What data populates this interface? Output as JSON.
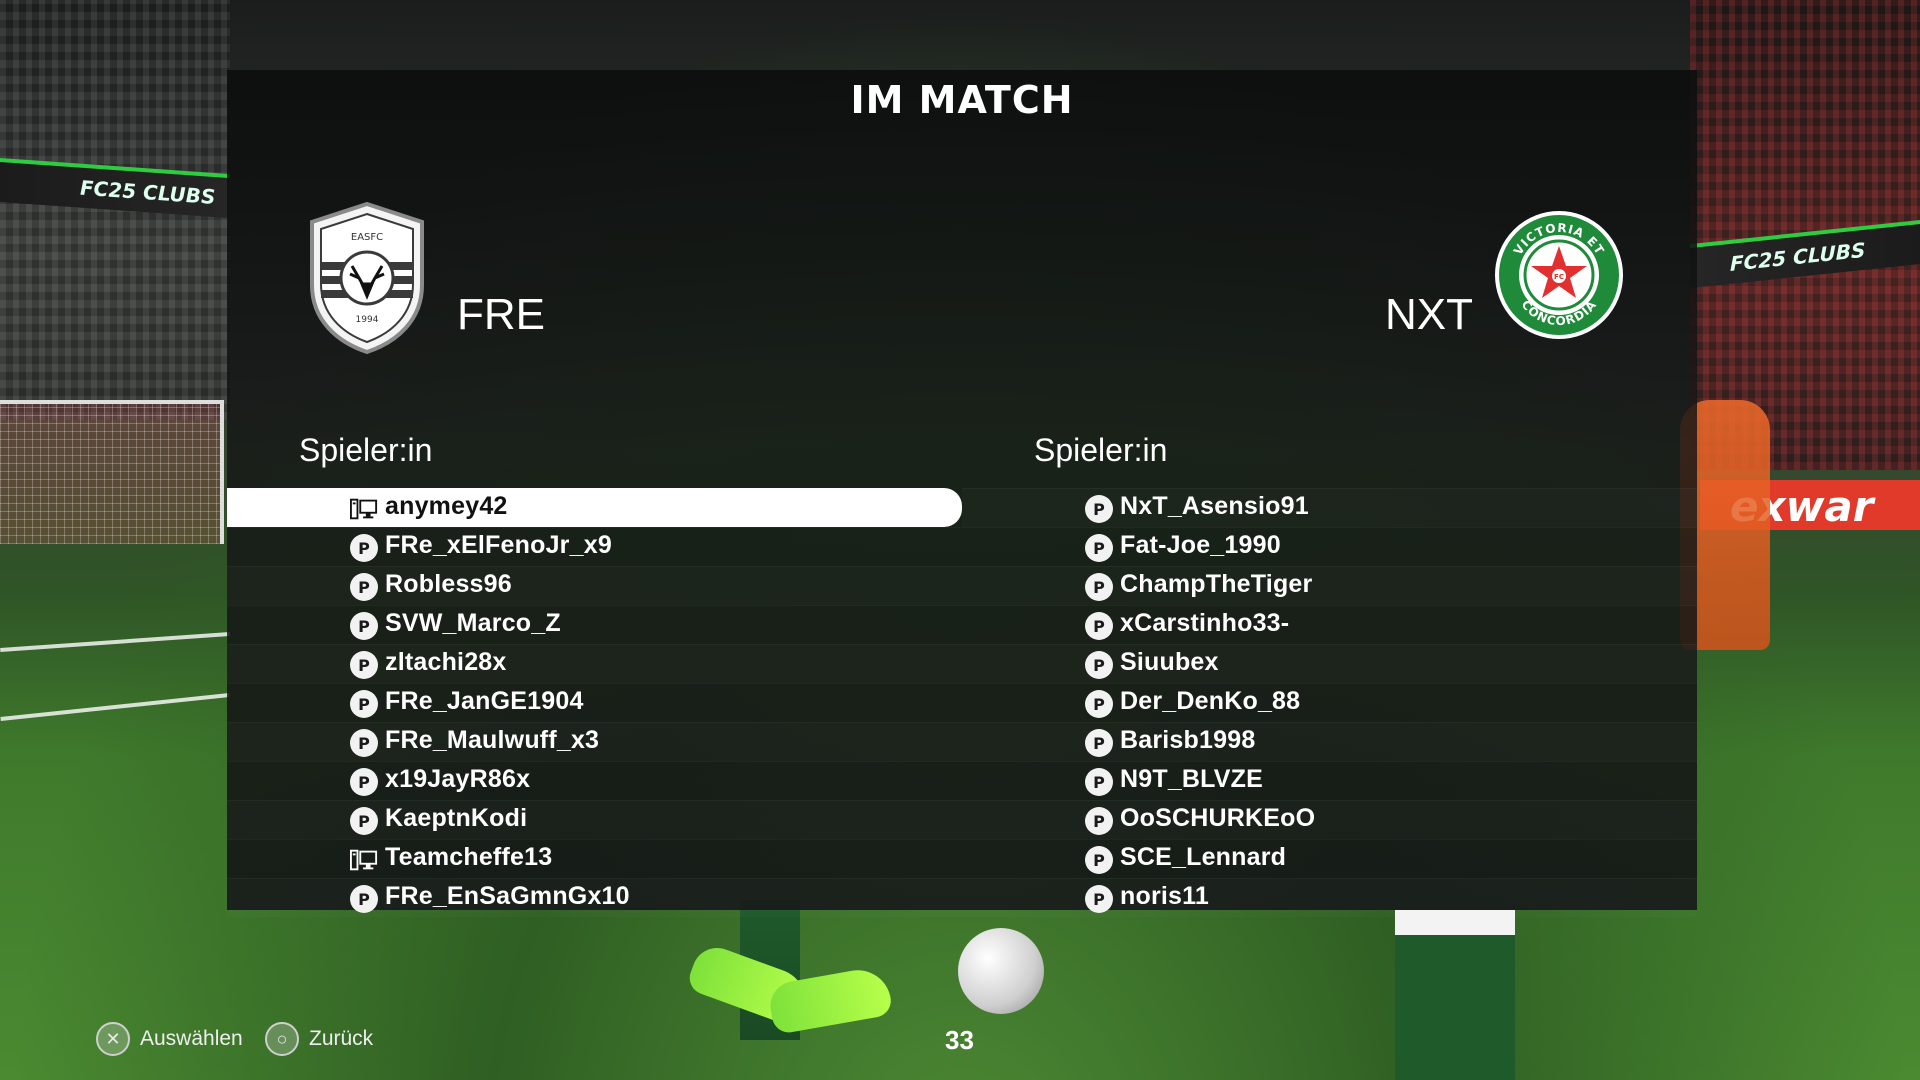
{
  "title": "IM MATCH",
  "backdrop": {
    "board_left_text": "FC25 CLUBS",
    "board_right_text": "FC25 CLUBS",
    "pitch_board_right": "exwar"
  },
  "home": {
    "abbr": "FRE",
    "crest": {
      "top_text": "EASFC",
      "year": "1994",
      "icon": "deer-icon",
      "color": "#3a3a3a"
    },
    "column_header": "Spieler:in",
    "players": [
      {
        "name": "anymey42",
        "platform": "pc-icon",
        "selected": true
      },
      {
        "name": "FRe_xElFenoJr_x9",
        "platform": "playstation-icon"
      },
      {
        "name": "Robless96",
        "platform": "playstation-icon"
      },
      {
        "name": "SVW_Marco_Z",
        "platform": "playstation-icon"
      },
      {
        "name": "zltachi28x",
        "platform": "playstation-icon"
      },
      {
        "name": "FRe_JanGE1904",
        "platform": "playstation-icon"
      },
      {
        "name": "FRe_Maulwuff_x3",
        "platform": "playstation-icon"
      },
      {
        "name": "x19JayR86x",
        "platform": "playstation-icon"
      },
      {
        "name": "KaeptnKodi",
        "platform": "playstation-icon"
      },
      {
        "name": "Teamcheffe13",
        "platform": "pc-icon"
      },
      {
        "name": "FRe_EnSaGmnGx10",
        "platform": "playstation-icon"
      }
    ]
  },
  "away": {
    "abbr": "NXT",
    "crest": {
      "top_text": "VICTORIA ET",
      "bottom_text": "CONCORDIA",
      "center_text": "FC",
      "color": "#1f8a3a",
      "star_color": "#e23030"
    },
    "column_header": "Spieler:in",
    "players": [
      {
        "name": "NxT_Asensio91",
        "platform": "playstation-icon"
      },
      {
        "name": "Fat-Joe_1990",
        "platform": "playstation-icon"
      },
      {
        "name": "ChampTheTiger",
        "platform": "playstation-icon"
      },
      {
        "name": "xCarstinho33-",
        "platform": "playstation-icon"
      },
      {
        "name": "Siuubex",
        "platform": "playstation-icon"
      },
      {
        "name": "Der_DenKo_88",
        "platform": "playstation-icon"
      },
      {
        "name": "Barisb1998",
        "platform": "playstation-icon"
      },
      {
        "name": "N9T_BLVZE",
        "platform": "playstation-icon"
      },
      {
        "name": "OoSCHURKEoO",
        "platform": "playstation-icon"
      },
      {
        "name": "SCE_Lennard",
        "platform": "playstation-icon"
      },
      {
        "name": "noris11",
        "platform": "playstation-icon"
      }
    ]
  },
  "footer": {
    "select_icon": "cross-button-icon",
    "select_label": "Auswählen",
    "back_icon": "circle-button-icon",
    "back_label": "Zurück",
    "timer": "33"
  }
}
